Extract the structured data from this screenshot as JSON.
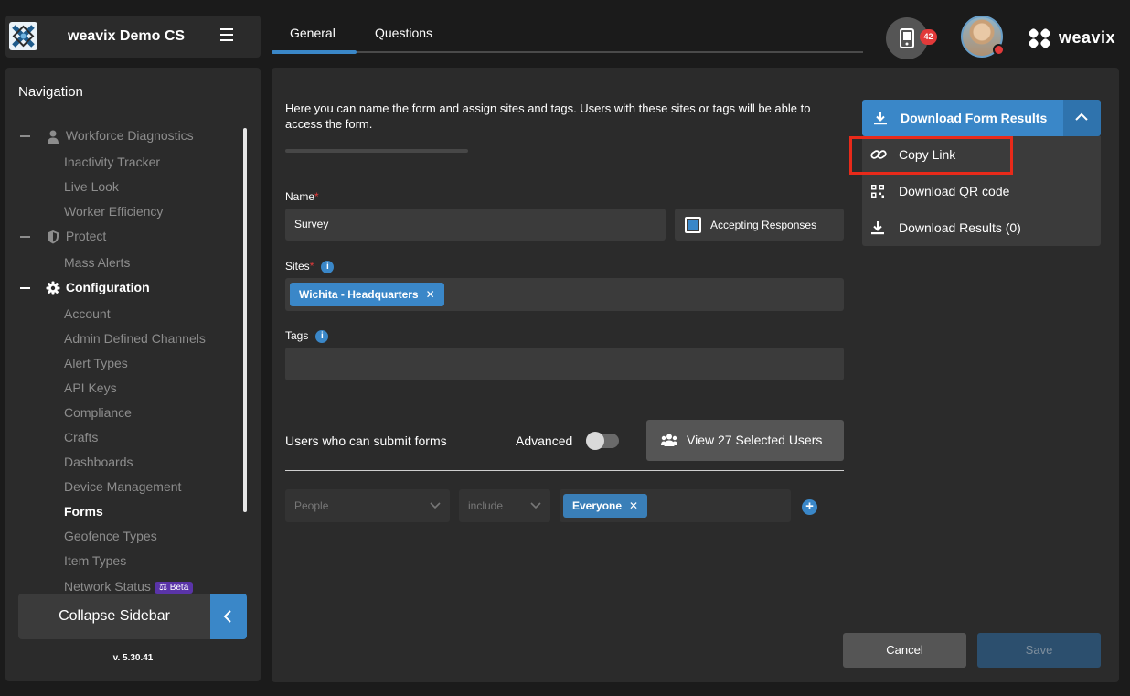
{
  "header": {
    "brand_name": "weavix Demo CS",
    "logo_word": "weavix"
  },
  "notifications": {
    "count": "42"
  },
  "tabs": [
    {
      "label": "General"
    },
    {
      "label": "Questions"
    }
  ],
  "sidebar": {
    "title": "Navigation",
    "sections": {
      "workforce": "Workforce Diagnostics",
      "protect": "Protect",
      "configuration": "Configuration"
    },
    "items": {
      "inactivity": "Inactivity Tracker",
      "live_look": "Live Look",
      "worker_efficiency": "Worker Efficiency",
      "mass_alerts": "Mass Alerts",
      "account": "Account",
      "admin_channels": "Admin Defined Channels",
      "alert_types": "Alert Types",
      "api_keys": "API Keys",
      "compliance": "Compliance",
      "crafts": "Crafts",
      "dashboards": "Dashboards",
      "device_management": "Device Management",
      "forms": "Forms",
      "geofence_types": "Geofence Types",
      "item_types": "Item Types",
      "network_status": "Network Status"
    },
    "beta_label": "Beta",
    "collapse_label": "Collapse Sidebar",
    "version": "v. 5.30.41"
  },
  "form": {
    "intro": "Here you can name the form and assign sites and tags. Users with these sites or tags will be able to access the form.",
    "name_label": "Name",
    "name_value": "Survey",
    "accepting_label": "Accepting Responses",
    "sites_label": "Sites",
    "site_chip": "Wichita - Headquarters",
    "tags_label": "Tags",
    "users_label": "Users who can submit forms",
    "advanced_label": "Advanced",
    "view_users_label": "View 27 Selected Users",
    "people_placeholder": "People",
    "include_placeholder": "include",
    "everyone_chip": "Everyone",
    "cancel_label": "Cancel",
    "save_label": "Save"
  },
  "download": {
    "button_label": "Download Form Results",
    "menu": {
      "copy_link": "Copy Link",
      "qr_code": "Download QR code",
      "results": "Download Results (0)"
    }
  },
  "colors": {
    "accent": "#3a87c8",
    "highlight": "#e82a1a",
    "badge": "#e23a3a",
    "beta": "#5a34a8"
  }
}
